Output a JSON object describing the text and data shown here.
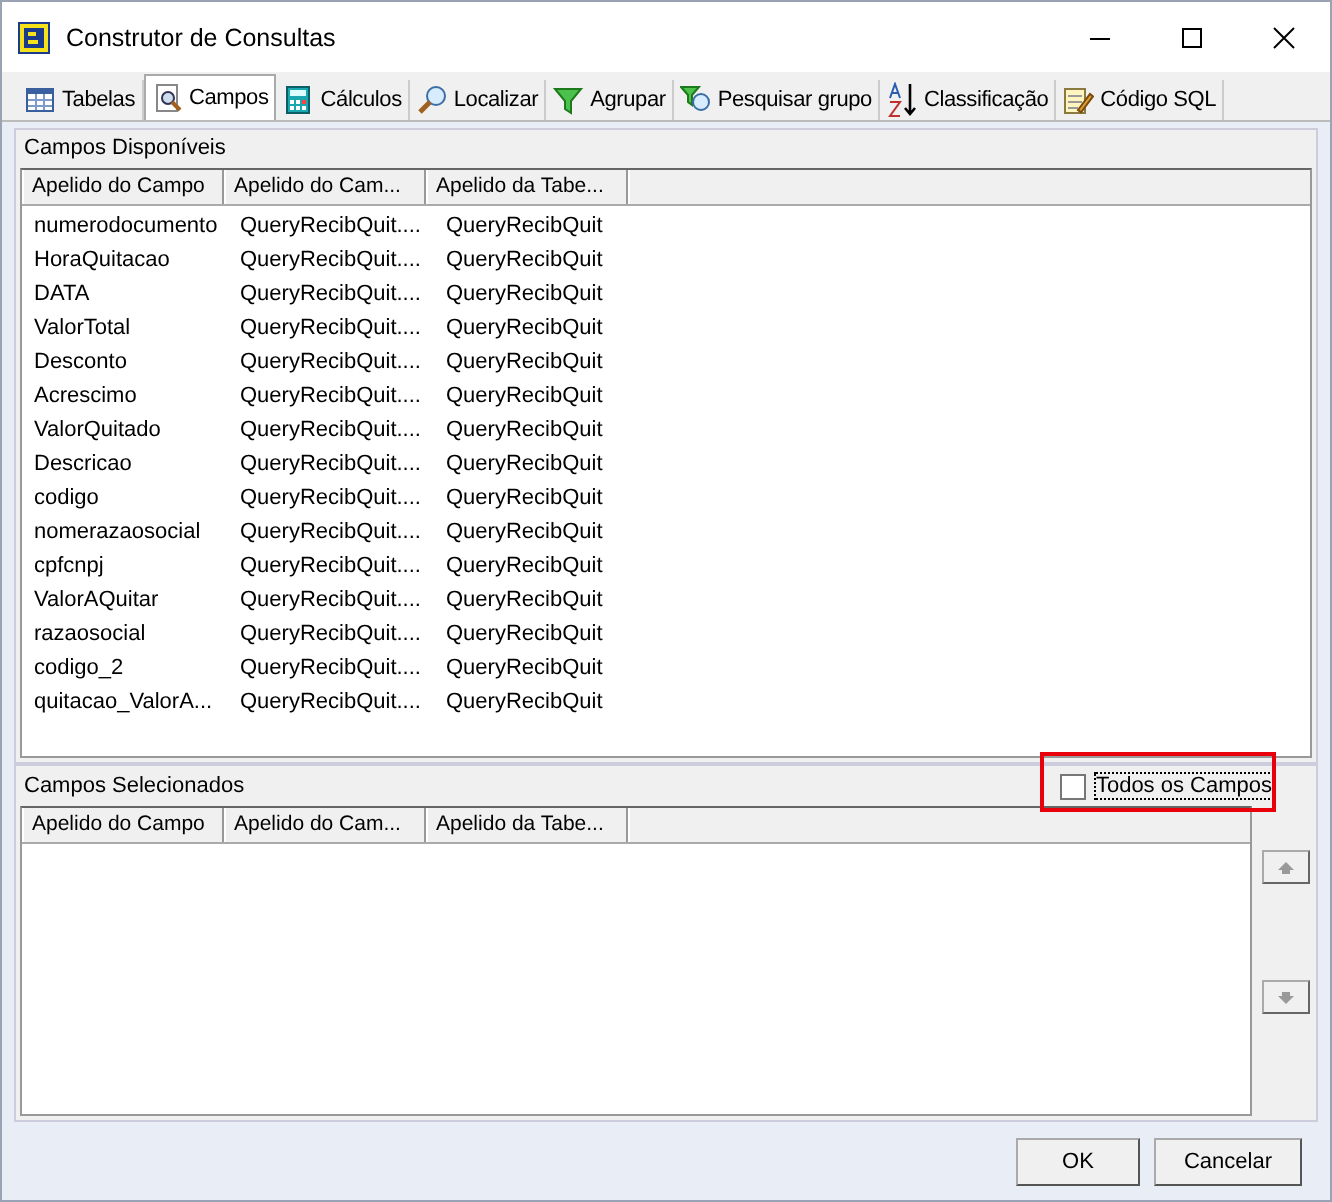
{
  "window": {
    "title": "Construtor de Consultas"
  },
  "tabs": [
    {
      "label": "Tabelas",
      "selected": false
    },
    {
      "label": "Campos",
      "selected": true
    },
    {
      "label": "Cálculos",
      "selected": false
    },
    {
      "label": "Localizar",
      "selected": false
    },
    {
      "label": "Agrupar",
      "selected": false
    },
    {
      "label": "Pesquisar grupo",
      "selected": false
    },
    {
      "label": "Classificação",
      "selected": false
    },
    {
      "label": "Código SQL",
      "selected": false
    }
  ],
  "available": {
    "title": "Campos Disponíveis",
    "columns": [
      "Apelido do Campo",
      "Apelido do Cam...",
      "Apelido da Tabe..."
    ],
    "rows": [
      [
        "numerodocumento",
        "QueryRecibQuit....",
        "QueryRecibQuit"
      ],
      [
        "HoraQuitacao",
        "QueryRecibQuit....",
        "QueryRecibQuit"
      ],
      [
        "DATA",
        "QueryRecibQuit....",
        "QueryRecibQuit"
      ],
      [
        "ValorTotal",
        "QueryRecibQuit....",
        "QueryRecibQuit"
      ],
      [
        "Desconto",
        "QueryRecibQuit....",
        "QueryRecibQuit"
      ],
      [
        "Acrescimo",
        "QueryRecibQuit....",
        "QueryRecibQuit"
      ],
      [
        "ValorQuitado",
        "QueryRecibQuit....",
        "QueryRecibQuit"
      ],
      [
        "Descricao",
        "QueryRecibQuit....",
        "QueryRecibQuit"
      ],
      [
        "codigo",
        "QueryRecibQuit....",
        "QueryRecibQuit"
      ],
      [
        "nomerazaosocial",
        "QueryRecibQuit....",
        "QueryRecibQuit"
      ],
      [
        "cpfcnpj",
        "QueryRecibQuit....",
        "QueryRecibQuit"
      ],
      [
        "ValorAQuitar",
        "QueryRecibQuit....",
        "QueryRecibQuit"
      ],
      [
        "razaosocial",
        "QueryRecibQuit....",
        "QueryRecibQuit"
      ],
      [
        "codigo_2",
        "QueryRecibQuit....",
        "QueryRecibQuit"
      ],
      [
        "quitacao_ValorA...",
        "QueryRecibQuit....",
        "QueryRecibQuit"
      ]
    ]
  },
  "selected_fields": {
    "title": "Campos Selecionados",
    "columns": [
      "Apelido do Campo",
      "Apelido do Cam...",
      "Apelido da Tabe..."
    ],
    "all_fields": {
      "label": "Todos os Campos",
      "checked": false
    }
  },
  "buttons": [
    "OK",
    "Cancelar"
  ]
}
